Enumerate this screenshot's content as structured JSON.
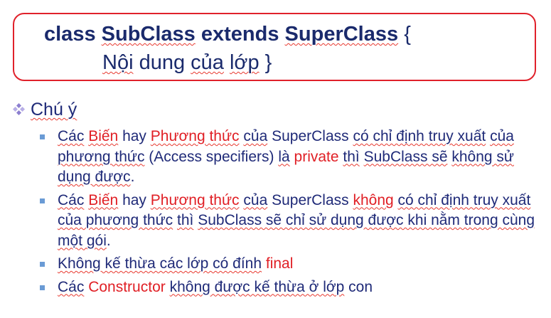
{
  "code": {
    "line1": {
      "kw_class": "class",
      "sub": "SubClass",
      "kw_extends": "extends",
      "sup": "SuperClass",
      "brace": "{"
    },
    "line2": {
      "w1": "Nội",
      "w2": " dung ",
      "w3": "của",
      "w4": " ",
      "w5": "lớp",
      "w6": " }"
    }
  },
  "heading": {
    "label": "Chú ý"
  },
  "bullets": [
    {
      "parts": [
        {
          "t": "Các",
          "red": false,
          "sq": true
        },
        {
          "t": " ",
          "red": false,
          "sq": false
        },
        {
          "t": "Biến",
          "red": true,
          "sq": true
        },
        {
          "t": " hay ",
          "red": false,
          "sq": false
        },
        {
          "t": "Phương thức",
          "red": true,
          "sq": true
        },
        {
          "t": " ",
          "red": false,
          "sq": false
        },
        {
          "t": "của",
          "red": false,
          "sq": true
        },
        {
          "t": " SuperClass ",
          "red": false,
          "sq": false
        },
        {
          "t": "có chỉ định truy xuất",
          "red": false,
          "sq": true
        },
        {
          "t": " ",
          "red": false,
          "sq": false
        },
        {
          "t": "của phương thức",
          "red": false,
          "sq": true
        },
        {
          "t": " (Access specifiers) ",
          "red": false,
          "sq": false
        },
        {
          "t": "là",
          "red": false,
          "sq": true
        },
        {
          "t": " ",
          "red": false,
          "sq": false
        },
        {
          "t": "private",
          "red": true,
          "sq": false
        },
        {
          "t": " ",
          "red": false,
          "sq": false
        },
        {
          "t": "thì",
          "red": false,
          "sq": true
        },
        {
          "t": " ",
          "red": false,
          "sq": false
        },
        {
          "t": "SubClass sẽ",
          "red": false,
          "sq": true
        },
        {
          "t": " ",
          "red": false,
          "sq": false
        },
        {
          "t": "không sử dụng được",
          "red": false,
          "sq": true
        },
        {
          "t": ".",
          "red": false,
          "sq": false
        }
      ]
    },
    {
      "parts": [
        {
          "t": "Các",
          "red": false,
          "sq": true
        },
        {
          "t": " ",
          "red": false,
          "sq": false
        },
        {
          "t": "Biến",
          "red": true,
          "sq": true
        },
        {
          "t": " hay ",
          "red": false,
          "sq": false
        },
        {
          "t": "Phương thức",
          "red": true,
          "sq": true
        },
        {
          "t": " ",
          "red": false,
          "sq": false
        },
        {
          "t": "của",
          "red": false,
          "sq": true
        },
        {
          "t": " SuperClass ",
          "red": false,
          "sq": false
        },
        {
          "t": "không",
          "red": true,
          "sq": true
        },
        {
          "t": " ",
          "red": false,
          "sq": false
        },
        {
          "t": "có chỉ định truy xuất của phương thức",
          "red": false,
          "sq": true
        },
        {
          "t": " ",
          "red": false,
          "sq": false
        },
        {
          "t": "thì",
          "red": false,
          "sq": true
        },
        {
          "t": " ",
          "red": false,
          "sq": false
        },
        {
          "t": "SubClass sẽ chỉ sử dụng được khi nằm trong cùng một gói",
          "red": false,
          "sq": true
        },
        {
          "t": ".",
          "red": false,
          "sq": false
        }
      ]
    },
    {
      "parts": [
        {
          "t": "Không kế thừa các lớp có đính",
          "red": false,
          "sq": true
        },
        {
          "t": " ",
          "red": false,
          "sq": false
        },
        {
          "t": "final",
          "red": true,
          "sq": false
        }
      ]
    },
    {
      "parts": [
        {
          "t": "Các",
          "red": false,
          "sq": true
        },
        {
          "t": " ",
          "red": false,
          "sq": false
        },
        {
          "t": "Constructor",
          "red": true,
          "sq": false
        },
        {
          "t": " ",
          "red": false,
          "sq": false
        },
        {
          "t": "không được kế thừa ở lớp",
          "red": false,
          "sq": true
        },
        {
          "t": " con",
          "red": false,
          "sq": false
        }
      ]
    }
  ],
  "icons": {
    "heading_bullet": "four-diamond-bullet-icon",
    "list_bullet": "square-bullet-icon"
  },
  "colors": {
    "text": "#1f2a78",
    "highlight": "#e01f25",
    "box_border": "#e0212b",
    "bullet": "#6a9bd5"
  }
}
